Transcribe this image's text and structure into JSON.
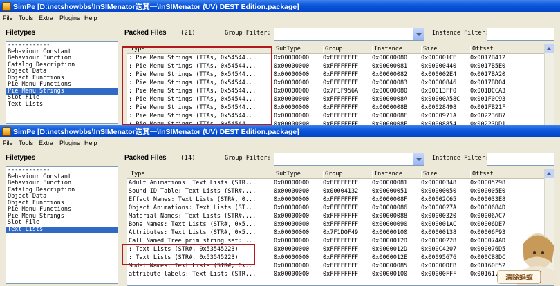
{
  "windows": [
    {
      "title": "SimPe [D:\\netshowbbs\\InSIMenator迭其一\\InSIMenator (UV) DEST Edition.package]",
      "menu": [
        "File",
        "Tools",
        "Extra",
        "Plugins",
        "Help"
      ],
      "filetypes_label": "Filetypes",
      "packed_files_label": "Packed Files",
      "packed_count": "(21)",
      "group_filter_label": "Group Filter:",
      "instance_filter_label": "Instance Filter:",
      "filetypes": [
        "------------",
        "Behaviour Constant",
        "Behaviour Function",
        "Catalog Description",
        "Object Data",
        "Object Functions",
        "Pie Menu Functions",
        "Pie Menu Strings",
        "Slot File",
        "Text Lists"
      ],
      "selected_filetype": "Pie Menu Strings",
      "columns": [
        "Type",
        "SubType",
        "Group",
        "Instance",
        "Size",
        "Offset"
      ],
      "rows": [
        [
          ": Pie Menu Strings (TTAs, 0x54544...",
          "0x00000000",
          "0xFFFFFFFF",
          "0x00000080",
          "0x000001CE",
          "0x0017B412"
        ],
        [
          ": Pie Menu Strings (TTAs, 0x54544...",
          "0x00000000",
          "0xFFFFFFFF",
          "0x00000081",
          "0x00000440",
          "0x0017B5E0"
        ],
        [
          ": Pie Menu Strings (TTAs, 0x54544...",
          "0x00000000",
          "0xFFFFFFFF",
          "0x00000082",
          "0x000002E4",
          "0x0017BA20"
        ],
        [
          ": Pie Menu Strings (TTAs, 0x54544...",
          "0x00000000",
          "0xFFFFFFFF",
          "0x00000083",
          "0x00000846",
          "0x0017BD04"
        ],
        [
          ": Pie Menu Strings (TTAs, 0x54544...",
          "0x00000000",
          "0x7F1F956A",
          "0x00000080",
          "0x00013FF0",
          "0x001DCCA3"
        ],
        [
          ": Pie Menu Strings (TTAs, 0x54544...",
          "0x00000000",
          "0xFFFFFFFF",
          "0x0000008A",
          "0x00000A58C",
          "0x001F0C93"
        ],
        [
          ": Pie Menu Strings (TTAs, 0x54544...",
          "0x00000000",
          "0xFFFFFFFF",
          "0x0000008B",
          "0x00028498",
          "0x001FB21F"
        ],
        [
          ": Pie Menu Strings (TTAs, 0x54544...",
          "0x00000000",
          "0xFFFFFFFF",
          "0x0000008E",
          "0x0000971A",
          "0x002236B7"
        ],
        [
          ": Pie Menu Strings (TTAs, 0x54544...",
          "0x00000000",
          "0xFFFFFFFF",
          "0x0000008F",
          "0x00008854",
          "0x00223DD1"
        ]
      ]
    },
    {
      "title": "SimPe [D:\\netshowbbs\\InSIMenator迭其一\\InSIMenator (UV) DEST Edition.package]",
      "menu": [
        "File",
        "Tools",
        "Extra",
        "Plugins",
        "Help"
      ],
      "filetypes_label": "Filetypes",
      "packed_files_label": "Packed Files",
      "packed_count": "(14)",
      "group_filter_label": "Group Filter:",
      "instance_filter_label": "Instance Filter:",
      "filetypes": [
        "------------",
        "Behaviour Constant",
        "Behaviour Function",
        "Catalog Description",
        "Object Data",
        "Object Functions",
        "Pie Menu Functions",
        "Pie Menu Strings",
        "Slot File",
        "Text Lists"
      ],
      "selected_filetype": "Text Lists",
      "columns": [
        "Type",
        "SubType",
        "Group",
        "Instance",
        "Size",
        "Offset"
      ],
      "rows": [
        [
          "Adult Animations: Text Lists (STR...",
          "0x00000000",
          "0xFFFFFFFF",
          "0x00000081",
          "0x00000348",
          "0x00005298"
        ],
        [
          "Sound ID Table: Text Lists (STR#,...",
          "0x00000000",
          "0x00004132",
          "0x00000051",
          "0x00000050",
          "0x000005E0"
        ],
        [
          "Effect Names: Text Lists (STR#, 0...",
          "0x00000000",
          "0xFFFFFFFF",
          "0x0000008F",
          "0x00002C65",
          "0x000033E8"
        ],
        [
          "Object Animations: Text Lists (ST...",
          "0x00000000",
          "0xFFFFFFFF",
          "0x00000086",
          "0x0000027A",
          "0x0000684D"
        ],
        [
          "Material Names: Text Lists (STR#,...",
          "0x00000000",
          "0xFFFFFFFF",
          "0x00000088",
          "0x00000320",
          "0x00006AC7"
        ],
        [
          "Bone Names: Text Lists (STR#, 0x5...",
          "0x00000000",
          "0xFFFFFFFF",
          "0x00000090",
          "0x000001AC",
          "0x00006DE7"
        ],
        [
          "Attributes: Text Lists (STR#, 0x5...",
          "0x00000000",
          "0x7F1DOF49",
          "0x00000100",
          "0x00000138",
          "0x00006F93"
        ],
        [
          "Call Named Tree prim string set: ...",
          "0x00000000",
          "0xFFFFFFFF",
          "0x0000012D",
          "0x00000228",
          "0x000074AD"
        ],
        [
          ": Text Lists (STR#, 0x53545223)",
          "0x00000000",
          "0xFFFFFFFF",
          "0x0000012D",
          "0x000C4207",
          "0x000076D5"
        ],
        [
          ": Text Lists (STR#, 0x53545223)",
          "0x00000000",
          "0xFFFFFFFF",
          "0x0000012E",
          "0x00095676",
          "0x000CB8DC"
        ],
        [
          "Model Names: Text Lists (STR#, 0x...",
          "0x00000000",
          "0xFFFFFFFF",
          "0x00000085",
          "0x00000DFB",
          "0x00160F52"
        ],
        [
          "attribute labels: Text Lists (STR...",
          "0x00000000",
          "0xFFFFFFFF",
          "0x00000100",
          "0x00000FFF",
          "0x00161..."
        ]
      ]
    }
  ],
  "mascot_text": "清除蚂蚁"
}
